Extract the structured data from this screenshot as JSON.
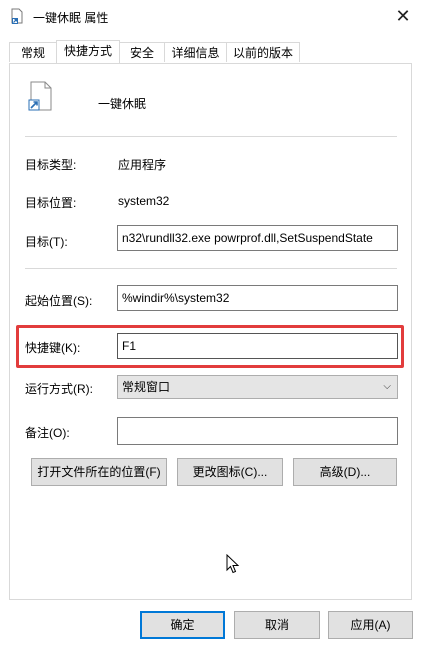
{
  "window": {
    "title": "一键休眠 属性",
    "close_icon": "close-icon"
  },
  "tabs": [
    {
      "label": "常规"
    },
    {
      "label": "快捷方式"
    },
    {
      "label": "安全"
    },
    {
      "label": "详细信息"
    },
    {
      "label": "以前的版本"
    }
  ],
  "shortcut": {
    "name": "一键休眠",
    "target_type_label": "目标类型:",
    "target_type_value": "应用程序",
    "target_location_label": "目标位置:",
    "target_location_value": "system32",
    "target_label": "目标(T):",
    "target_value": "n32\\rundll32.exe powrprof.dll,SetSuspendState",
    "start_in_label": "起始位置(S):",
    "start_in_value": "%windir%\\system32",
    "hotkey_label": "快捷键(K):",
    "hotkey_value": "F1",
    "run_label": "运行方式(R):",
    "run_value": "常规窗口",
    "comment_label": "备注(O):",
    "comment_value": ""
  },
  "actions": {
    "open_location": "打开文件所在的位置(F)",
    "change_icon": "更改图标(C)...",
    "advanced": "高级(D)..."
  },
  "footer": {
    "ok": "确定",
    "cancel": "取消",
    "apply": "应用(A)"
  },
  "colors": {
    "highlight": "#e23c3c",
    "focus": "#0078d7"
  }
}
